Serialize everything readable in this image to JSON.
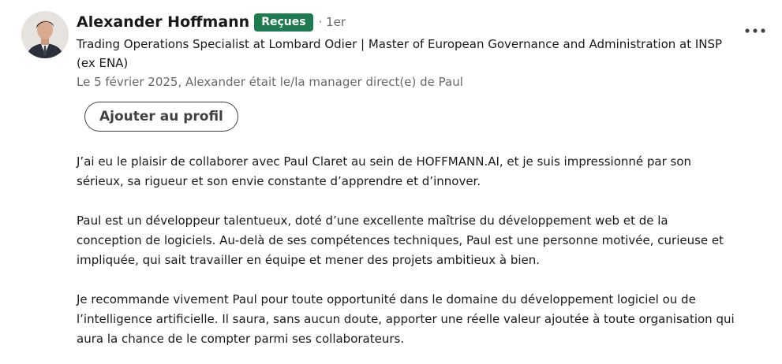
{
  "recommendation": {
    "author": {
      "name": "Alexander Hoffmann",
      "badge": "Reçues",
      "degree": "· 1er",
      "headline": "Trading Operations Specialist at Lombard Odier | Master of European Governance and Administration at INSP (ex ENA)",
      "relation": "Le 5 février 2025, Alexander était le/la manager direct(e) de Paul"
    },
    "add_button_label": "Ajouter au profil",
    "more_icon": "ellipsis-icon",
    "paragraphs": [
      "J’ai eu le plaisir de collaborer avec Paul Claret au sein de HOFFMANN.AI, et je suis impressionné par son sérieux, sa rigueur et son envie constante d’apprendre et d’innover.",
      "Paul est un développeur talentueux, doté d’une excellente maîtrise du développement web et de la conception de logiciels. Au-delà de ses compétences techniques, Paul est une personne motivée, curieuse et impliquée, qui sait travailler en équipe et mener des projets ambitieux à bien.",
      "Je recommande vivement Paul pour toute opportunité dans le domaine du développement logiciel ou de l’intelligence artificielle. Il saura, sans aucun doute, apporter une réelle valeur ajoutée à toute organisation qui aura la chance de le compter parmi ses collaborateurs."
    ]
  },
  "colors": {
    "badge_bg": "#1e7a4f",
    "text_primary": "#1a1a1a",
    "text_secondary": "#666666"
  }
}
